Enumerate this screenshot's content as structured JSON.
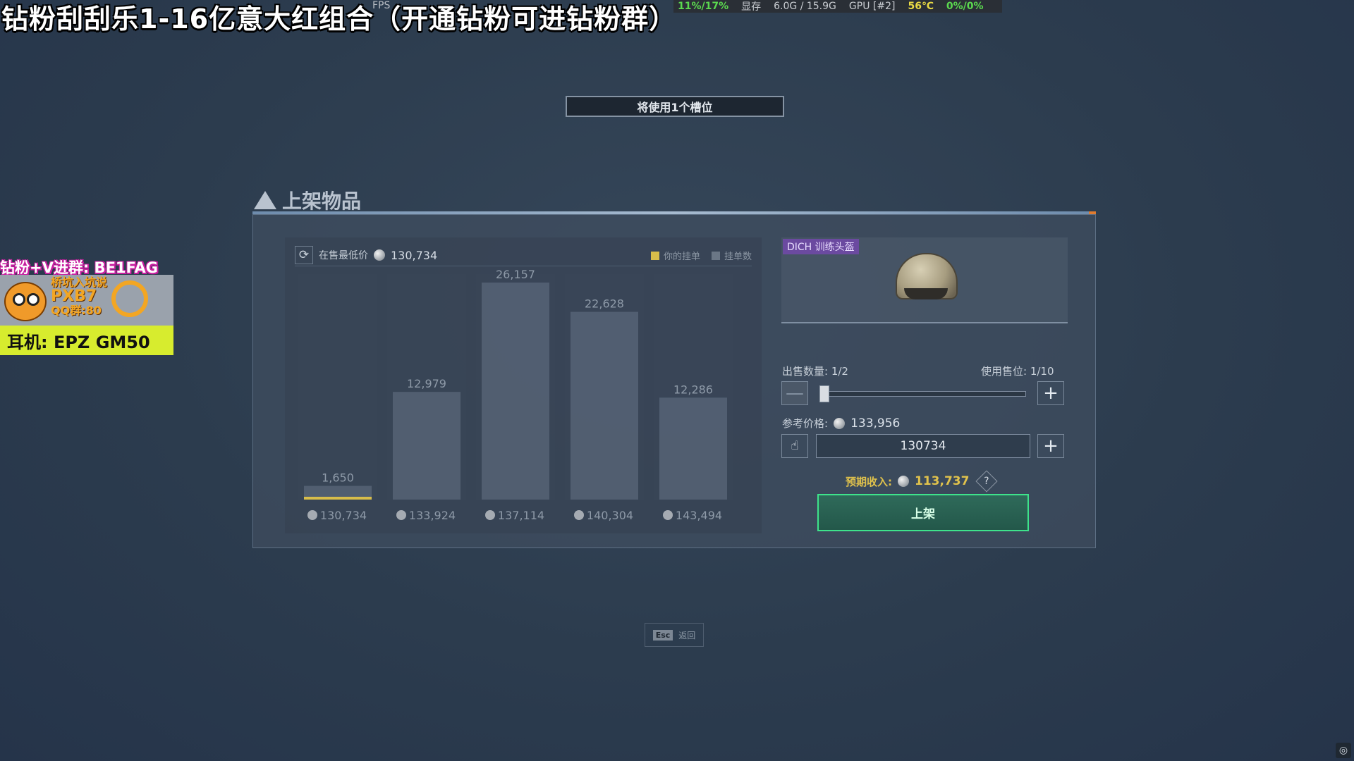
{
  "overlay": {
    "stream_title": "钻粉刮刮乐1-16亿意大红组合（开通钻粉可进钻粉群）",
    "fps_label": "FPS",
    "perf": {
      "cpu": "11%/17%",
      "vram_label": "显存",
      "vram": "6.0G / 15.9G",
      "gpu_label": "GPU [#2]",
      "temp": "56℃",
      "usage": "0%/0%"
    },
    "promo": {
      "line1": "钻粉+V进群: BE1FAG",
      "image_text_1": "桥坑入坑说",
      "image_text_2": "PXB7",
      "image_text_3": "QQ群:80",
      "earphone": "耳机: EPZ GM50"
    }
  },
  "slot_banner": "将使用1个槽位",
  "panel": {
    "title": "上架物品"
  },
  "chart_header": {
    "label": "在售最低价",
    "value": "130,734",
    "legend": [
      {
        "label": "你的挂单",
        "color": "#d8bd4a"
      },
      {
        "label": "挂单数",
        "color": "#6b7786"
      }
    ]
  },
  "chart_data": {
    "type": "bar",
    "categories": [
      "130,734",
      "133,924",
      "137,114",
      "140,304",
      "143,494"
    ],
    "values": [
      1650,
      12979,
      26157,
      22628,
      12286
    ],
    "value_labels": [
      "1,650",
      "12,979",
      "26,157",
      "22,628",
      "12,286"
    ],
    "highlight_index": 0,
    "title": "",
    "xlabel": "",
    "ylabel": ""
  },
  "item": {
    "name": "DICH 训练头盔"
  },
  "form": {
    "qty_label": "出售数量: 1/2",
    "slot_label": "使用售位: 1/10",
    "slider_value": 0.5,
    "ref_label": "参考价格:",
    "ref_value": "133,956",
    "price_input": "130734",
    "income_label": "预期收入:",
    "income_value": "113,737",
    "list_button": "上架"
  },
  "esc": {
    "key": "Esc",
    "label": "返回"
  },
  "colors": {
    "accent_green": "#3ee38b",
    "gold": "#e0c24c",
    "your_order": "#d8bd4a"
  }
}
